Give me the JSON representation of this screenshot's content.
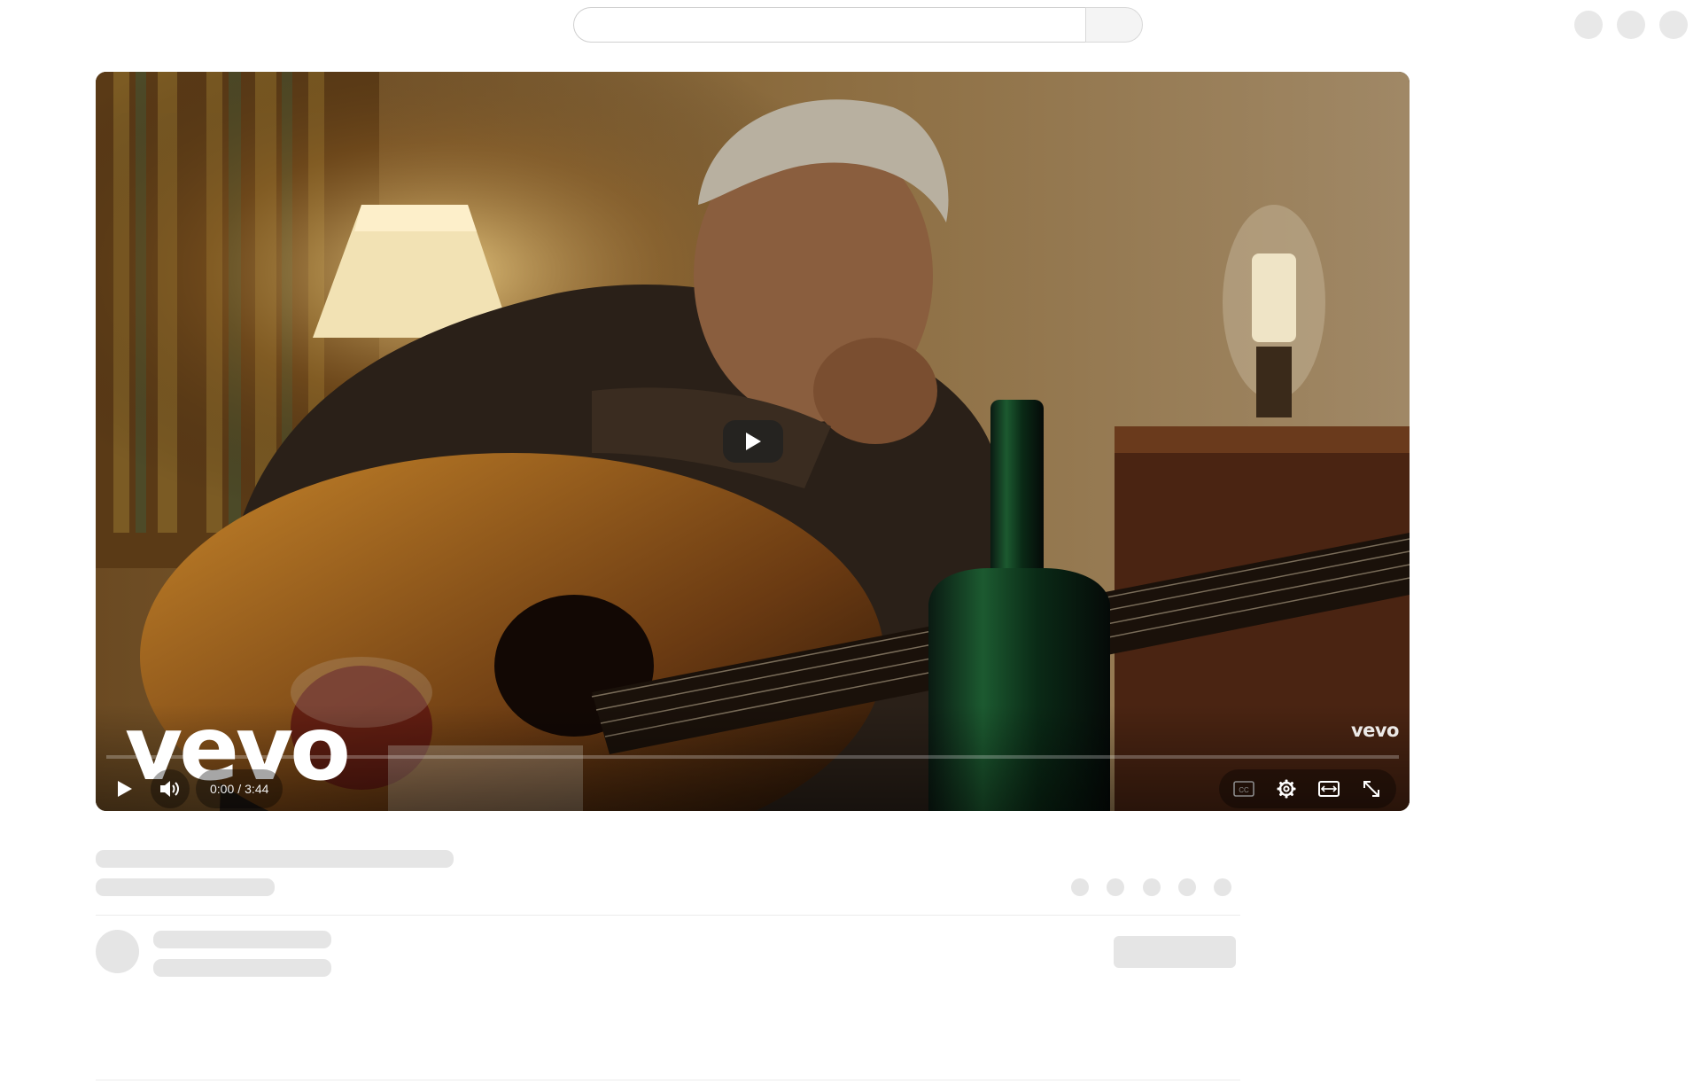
{
  "masthead": {
    "search_placeholder": "",
    "search_icon": "search-icon",
    "profile_circles": 3
  },
  "player": {
    "state": "paused",
    "big_play_icon": "play-icon",
    "watermark_logo": "vevo",
    "watermark_corner": "vevo",
    "progress_fraction": 0,
    "current_time": "0:00",
    "duration": "3:44",
    "time_separator": "/",
    "controls": {
      "play": "play-icon",
      "volume": "volume-icon",
      "captions": "closed-captions-icon",
      "settings": "gear-icon",
      "theater": "theater-mode-icon",
      "fullscreen": "fullscreen-icon"
    },
    "colors": {
      "progress_played": "#ff0000",
      "progress_track": "rgba(255,255,255,0.25)",
      "control_foreground": "#ffffff"
    }
  },
  "below_player": {
    "loading_skeleton": true,
    "action_dots": 5
  }
}
